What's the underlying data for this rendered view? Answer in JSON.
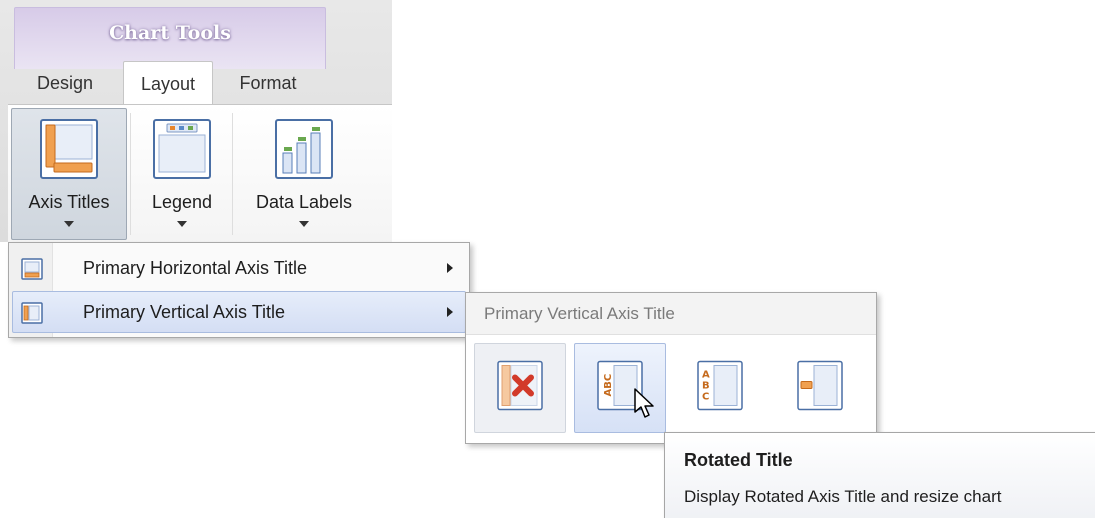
{
  "ribbon": {
    "context_title": "Chart Tools",
    "tabs": [
      {
        "label": "Design",
        "active": false
      },
      {
        "label": "Layout",
        "active": true
      },
      {
        "label": "Format",
        "active": false
      }
    ],
    "buttons": [
      {
        "label": "Axis Titles",
        "icon": "axis-titles-icon",
        "pressed": true
      },
      {
        "label": "Legend",
        "icon": "legend-icon",
        "pressed": false
      },
      {
        "label": "Data Labels",
        "icon": "data-labels-icon",
        "pressed": false
      }
    ]
  },
  "menu": {
    "items": [
      {
        "label": "Primary Horizontal Axis Title",
        "icon": "horizontal-axis-title-icon",
        "highlighted": false
      },
      {
        "label": "Primary Vertical Axis Title",
        "icon": "vertical-axis-title-icon",
        "highlighted": true
      }
    ]
  },
  "gallery": {
    "title": "Primary Vertical Axis Title",
    "items": [
      {
        "icon": "none-title-icon",
        "state": "pressed"
      },
      {
        "icon": "rotated-title-icon",
        "state": "hover"
      },
      {
        "icon": "vertical-title-icon",
        "state": "normal"
      },
      {
        "icon": "horizontal-title-icon",
        "state": "normal"
      }
    ]
  },
  "tooltip": {
    "title": "Rotated Title",
    "description": "Display Rotated Axis Title and resize chart"
  },
  "colors": {
    "context_tab": "#d7cbe8",
    "highlight": "#d4def4",
    "icon_orange": "#e8852a",
    "icon_blue": "#5a8ac6",
    "icon_green": "#6aa84f"
  }
}
